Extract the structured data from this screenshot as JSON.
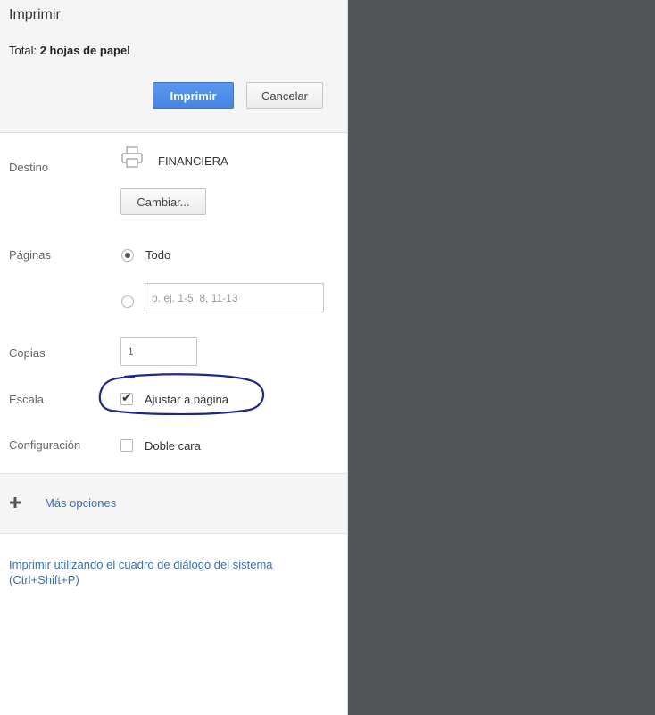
{
  "header": {
    "title": "Imprimir",
    "total_prefix": "Total: ",
    "total_value": "2 hojas de papel",
    "print_label": "Imprimir",
    "cancel_label": "Cancelar"
  },
  "destination": {
    "label": "Destino",
    "printer_name": "FINANCIERA",
    "printer_icon": "printer-icon",
    "change_label": "Cambiar..."
  },
  "pages": {
    "label": "Páginas",
    "option_all": "Todo",
    "selected": "all",
    "range_placeholder": "p. ej. 1-5, 8, 11-13"
  },
  "copies": {
    "label": "Copias",
    "value": "1"
  },
  "scale": {
    "label": "Escala",
    "fit_label": "Ajustar a página",
    "checked": true
  },
  "settings": {
    "label": "Configuración",
    "duplex_label": "Doble cara",
    "checked": false
  },
  "more_options": {
    "label": "Más opciones",
    "icon": "plus-icon"
  },
  "system_dialog": {
    "label": "Imprimir utilizando el cuadro de diálogo del sistema (Ctrl+Shift+P)"
  },
  "colors": {
    "primary": "#4785e0",
    "link": "#3a6fb0",
    "preview_bg": "#525659",
    "annotation": "#1a2a8c"
  }
}
